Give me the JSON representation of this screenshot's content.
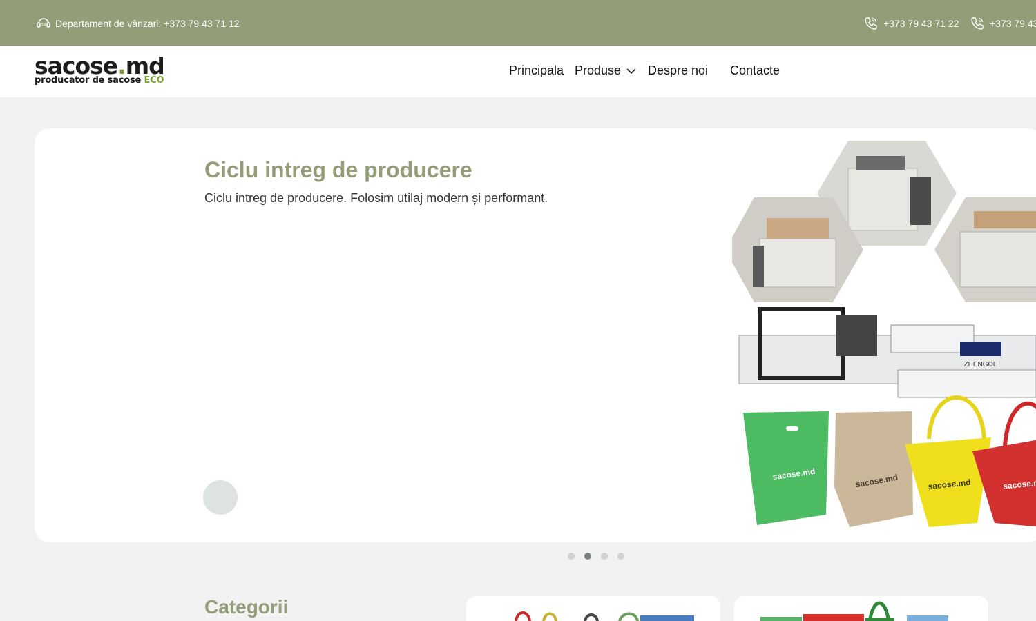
{
  "topbar": {
    "department_text": "Departament de vânzari: +373 79 43 71 12",
    "phone_1": "+373 79 43 71 22",
    "phone_2": "+373 79 43"
  },
  "logo": {
    "brand_dark_1": "sac",
    "brand_green_1": "ose",
    "brand_dot": ".",
    "brand_dark_2": "md",
    "tagline": "producator de sacose ",
    "tagline_eco": "ECO"
  },
  "nav": {
    "items": [
      "Principala",
      "Produse",
      "Despre noi",
      "Contacte"
    ]
  },
  "hero": {
    "title": "Ciclu intreg de producere",
    "text": "Ciclu intreg de producere. Folosim utilaj modern și performant.",
    "bag_labels": [
      "sacose.md",
      "sacose.md",
      "sacose.md",
      "sacose.m"
    ],
    "machine_label": "ZHENGDE"
  },
  "slider": {
    "dot_count": 4,
    "active_index": 1
  },
  "categories": {
    "title": "Categorii"
  },
  "colors": {
    "accent": "#939d77",
    "brand_green": "#7aa233"
  }
}
